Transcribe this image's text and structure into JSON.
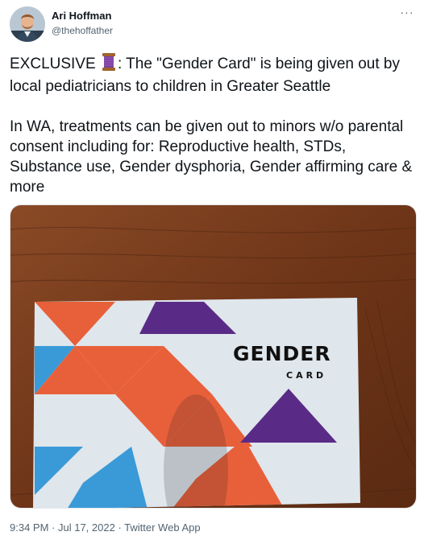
{
  "author": {
    "display_name": "Ari Hoffman",
    "handle": "@thehoffather",
    "avatar_icon": "profile-photo"
  },
  "menu": {
    "more_label": "···"
  },
  "tweet": {
    "para1_before": "EXCLUSIVE ",
    "para1_emoji": "thread-spool-emoji",
    "para1_after": ": The \"Gender Card\" is being given out by local pediatricians to children in Greater Seattle",
    "para2": "In WA, treatments can be given out to minors w/o parental consent including for: Reproductive health, STDs, Substance use, Gender dysphoria, Gender affirming care & more"
  },
  "photo": {
    "card_title": "GENDER",
    "card_subtitle": "CARD",
    "colors": {
      "orange": "#e8603a",
      "blue": "#3a9ad8",
      "purple": "#5a2b86",
      "card": "#dfe6ec"
    }
  },
  "footer": {
    "time": "9:34 PM",
    "separator": " · ",
    "date": "Jul 17, 2022",
    "source": "Twitter Web App"
  }
}
